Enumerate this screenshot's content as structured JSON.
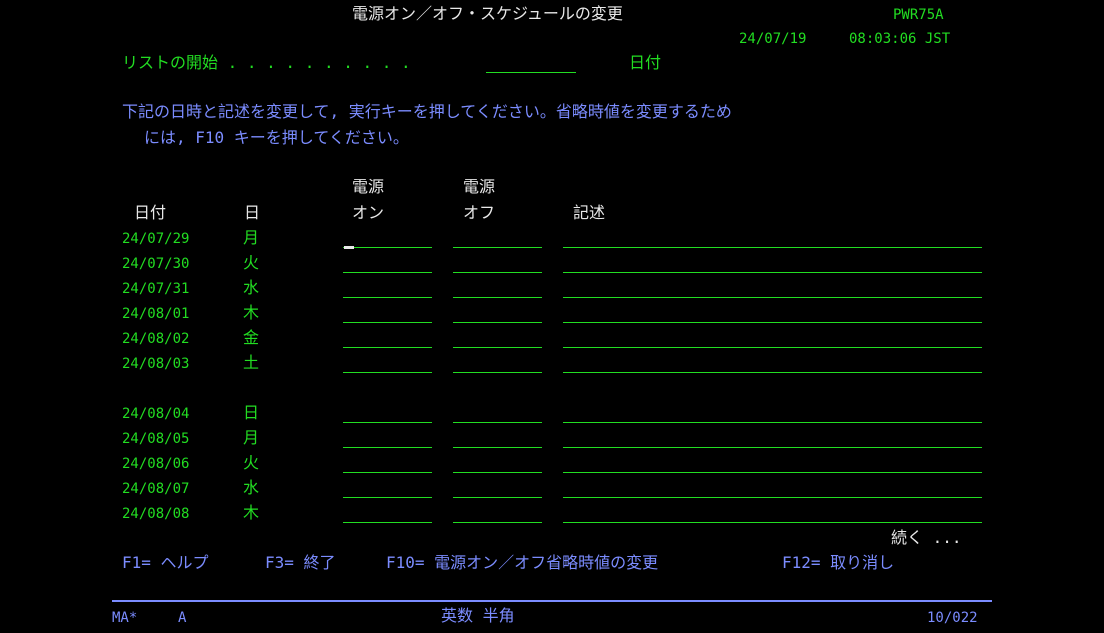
{
  "header": {
    "title": "電源オン／オフ・スケジュールの変更",
    "screen_id": "PWR75A",
    "date": "24/07/19",
    "time": "08:03:06 JST"
  },
  "list_start": {
    "label": "リストの開始 . . . . . . . . . .",
    "value": "",
    "hint": "日付"
  },
  "instructions": {
    "line1": "下記の日時と記述を変更して, 実行キーを押してください。省略時値を変更するため",
    "line2": "には, F10 キーを押してください。"
  },
  "columns": {
    "power_on_top": "電源",
    "power_on_bottom": "オン",
    "power_off_top": "電源",
    "power_off_bottom": "オフ",
    "date": "日付",
    "day": "日",
    "description": "記述"
  },
  "rows": [
    {
      "date": "24/07/29",
      "day": "月",
      "on": "",
      "off": "",
      "desc": ""
    },
    {
      "date": "24/07/30",
      "day": "火",
      "on": "",
      "off": "",
      "desc": ""
    },
    {
      "date": "24/07/31",
      "day": "水",
      "on": "",
      "off": "",
      "desc": ""
    },
    {
      "date": "24/08/01",
      "day": "木",
      "on": "",
      "off": "",
      "desc": ""
    },
    {
      "date": "24/08/02",
      "day": "金",
      "on": "",
      "off": "",
      "desc": ""
    },
    {
      "date": "24/08/03",
      "day": "土",
      "on": "",
      "off": "",
      "desc": ""
    },
    {
      "date": "24/08/04",
      "day": "日",
      "on": "",
      "off": "",
      "desc": ""
    },
    {
      "date": "24/08/05",
      "day": "月",
      "on": "",
      "off": "",
      "desc": ""
    },
    {
      "date": "24/08/06",
      "day": "火",
      "on": "",
      "off": "",
      "desc": ""
    },
    {
      "date": "24/08/07",
      "day": "水",
      "on": "",
      "off": "",
      "desc": ""
    },
    {
      "date": "24/08/08",
      "day": "木",
      "on": "",
      "off": "",
      "desc": ""
    }
  ],
  "more": "続く ...",
  "function_keys": {
    "f1": "F1= ヘルプ",
    "f3": "F3= 終了",
    "f10": "F10= 電源オン／オフ省略時値の変更",
    "f12": "F12= 取り消し"
  },
  "status": {
    "mode": "MA*",
    "session": "A",
    "input_mode": "英数 半角",
    "cursor_pos": "10/022"
  },
  "colors": {
    "background": "#000000",
    "green": "#22dd22",
    "white": "#e8e8e8",
    "blue": "#7b8cff"
  }
}
